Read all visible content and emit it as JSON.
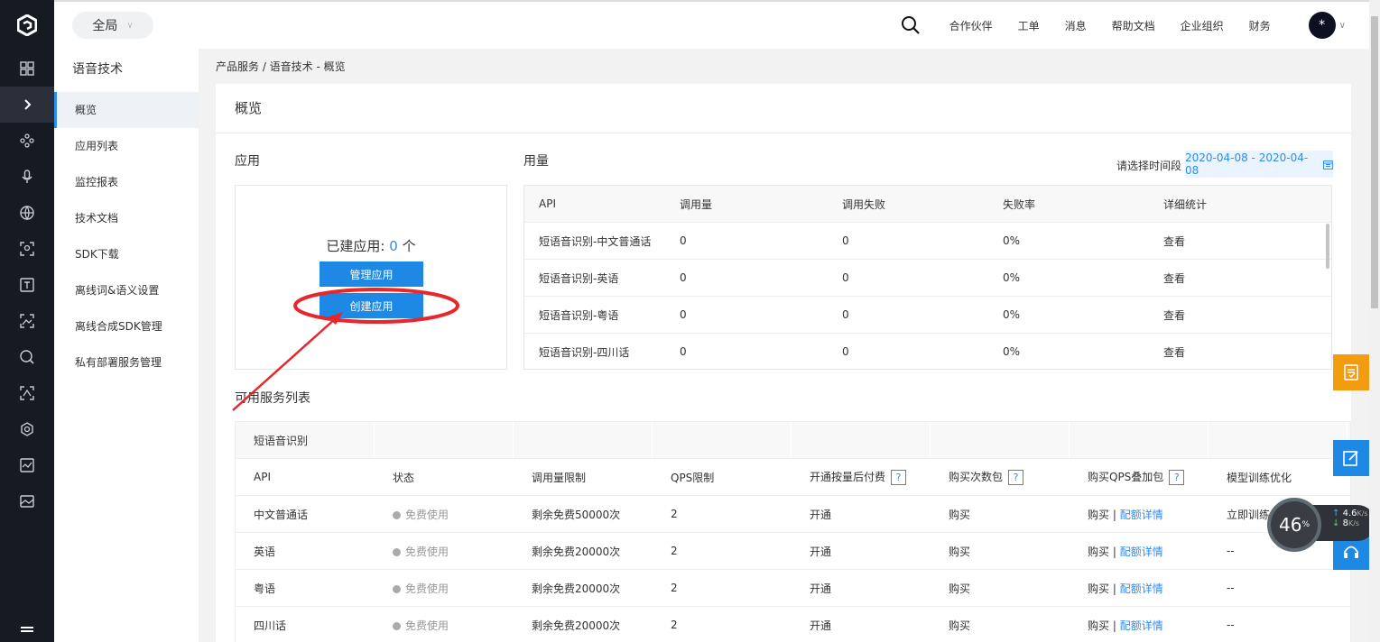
{
  "topbar": {
    "scope": "全局",
    "nav": [
      "合作伙伴",
      "工单",
      "消息",
      "帮助文档",
      "企业组织",
      "财务"
    ],
    "avatar": "*"
  },
  "sidebar": {
    "title": "语音技术",
    "items": [
      {
        "label": "概览",
        "active": true
      },
      {
        "label": "应用列表"
      },
      {
        "label": "监控报表"
      },
      {
        "label": "技术文档"
      },
      {
        "label": "SDK下载"
      },
      {
        "label": "离线词&语义设置"
      },
      {
        "label": "离线合成SDK管理"
      },
      {
        "label": "私有部署服务管理"
      }
    ]
  },
  "breadcrumb": "产品服务 / 语音技术 - 概览",
  "page_title": "概览",
  "apps": {
    "title": "应用",
    "count_label": "已建应用:",
    "count": "0",
    "count_unit": "个",
    "manage_button": "管理应用",
    "create_button": "创建应用"
  },
  "usage": {
    "title": "用量",
    "date_label": "请选择时间段",
    "date_range": "2020-04-08 - 2020-04-08",
    "headers": [
      "API",
      "调用量",
      "调用失败",
      "失败率",
      "详细统计"
    ],
    "rows": [
      [
        "短语音识别-中文普通话",
        "0",
        "0",
        "0%",
        "查看"
      ],
      [
        "短语音识别-英语",
        "0",
        "0",
        "0%",
        "查看"
      ],
      [
        "短语音识别-粤语",
        "0",
        "0",
        "0%",
        "查看"
      ],
      [
        "短语音识别-四川话",
        "0",
        "0",
        "0%",
        "查看"
      ]
    ]
  },
  "services": {
    "title": "可用服务列表",
    "group": "短语音识别",
    "headers": [
      "API",
      "状态",
      "调用量限制",
      "QPS限制",
      "开通按量后付费",
      "购买次数包",
      "购买QPS叠加包",
      "模型训练优化"
    ],
    "help": "?",
    "rows": [
      [
        "中文普通话",
        "免费使用",
        "剩余免费50000次",
        "2",
        "开通",
        "购买",
        "购买",
        "配额详情",
        "立即训练"
      ],
      [
        "英语",
        "免费使用",
        "剩余免费20000次",
        "2",
        "开通",
        "购买",
        "购买",
        "配额详情",
        "--"
      ],
      [
        "粤语",
        "免费使用",
        "剩余免费20000次",
        "2",
        "开通",
        "购买",
        "购买",
        "配额详情",
        "--"
      ],
      [
        "四川话",
        "免费使用",
        "剩余免费20000次",
        "2",
        "开通",
        "购买",
        "购买",
        "配额详情",
        "--"
      ]
    ],
    "sep": "|"
  },
  "speed_widget": {
    "percent": "46",
    "unit": "%",
    "up": "4.6",
    "up_unit": "K/s",
    "down": "8",
    "down_unit": "K/s"
  },
  "colors": {
    "accent": "#2d8cf0",
    "button": "#1e88e5",
    "annotation": "#e8262b",
    "float_orange": "#f39c12"
  }
}
